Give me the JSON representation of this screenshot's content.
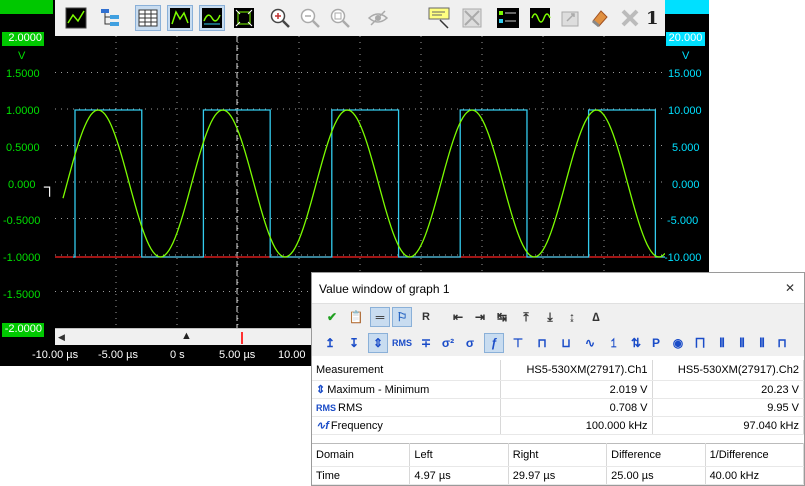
{
  "left_axis": {
    "ticks": [
      "2.0000",
      "V",
      "1.5000",
      "1.0000",
      "0.5000",
      "0.000",
      "-0.5000",
      "-1.0000",
      "-1.5000",
      "-2.0000"
    ],
    "top_value": "2.0000",
    "unit": "V",
    "bottom_value": "-2.0000"
  },
  "right_axis": {
    "top_value": "20.000",
    "unit": "V",
    "ticks": [
      "15.000",
      "10.000",
      "5.000",
      "0.000",
      "-5.000",
      "-10.000"
    ]
  },
  "time_axis": {
    "ticks": [
      "-10.00 µs",
      "-5.00 µs",
      "0 s",
      "5.00 µs",
      "10.00"
    ]
  },
  "toolbar": {
    "counter": "1",
    "icons": [
      "channel-view-icon",
      "tree-icon",
      "table-icon",
      "graph-sine-icon",
      "graph-square-icon",
      "fit-icon",
      "zoom-in-icon",
      "zoom-out-icon",
      "zoom-reset-icon",
      "eye-icon",
      "comment-text-icon",
      "cross-box-icon",
      "ch1-ch2-icon",
      "signal-icon",
      "scale-icon",
      "eraser-icon",
      "close-x-icon"
    ]
  },
  "colors": {
    "ch1": "#7cfc00",
    "ch2": "#33ccee",
    "grid": "#9a9a9a",
    "axis_green": "#00c800",
    "axis_cyan": "#00e0ff",
    "red_line": "#ff2020"
  },
  "value_window": {
    "title": "Value window of graph 1",
    "measure_header": {
      "label": "Measurement",
      "ch1": "HS5-530XM(27917).Ch1",
      "ch2": "HS5-530XM(27917).Ch2"
    },
    "measures": [
      {
        "icon": "max-min-icon",
        "label": "Maximum - Minimum",
        "ch1": "2.019 V",
        "ch2": "20.23 V"
      },
      {
        "icon": "rms-icon",
        "label": "RMS",
        "ch1": "0.708 V",
        "ch2": "9.95 V"
      },
      {
        "icon": "frequency-icon",
        "label": "Frequency",
        "ch1": "100.000 kHz",
        "ch2": "97.040 kHz"
      }
    ],
    "cursor_header": [
      "Domain",
      "Left",
      "Right",
      "Difference",
      "1/Difference"
    ],
    "cursor_row": [
      "Time",
      "4.97 µs",
      "29.97 µs",
      "25.00 µs",
      "40.00 kHz"
    ],
    "toolbar2_labels": [
      "RMS",
      "σ²",
      "σ",
      "P"
    ]
  },
  "waveform": {
    "ch1": {
      "type": "sine",
      "amplitude_V": 1.0,
      "frequency_kHz": 100.0
    },
    "ch2": {
      "type": "square",
      "high_V": 10.0,
      "low_V": -10.0,
      "frequency_kHz": 97.04
    }
  }
}
